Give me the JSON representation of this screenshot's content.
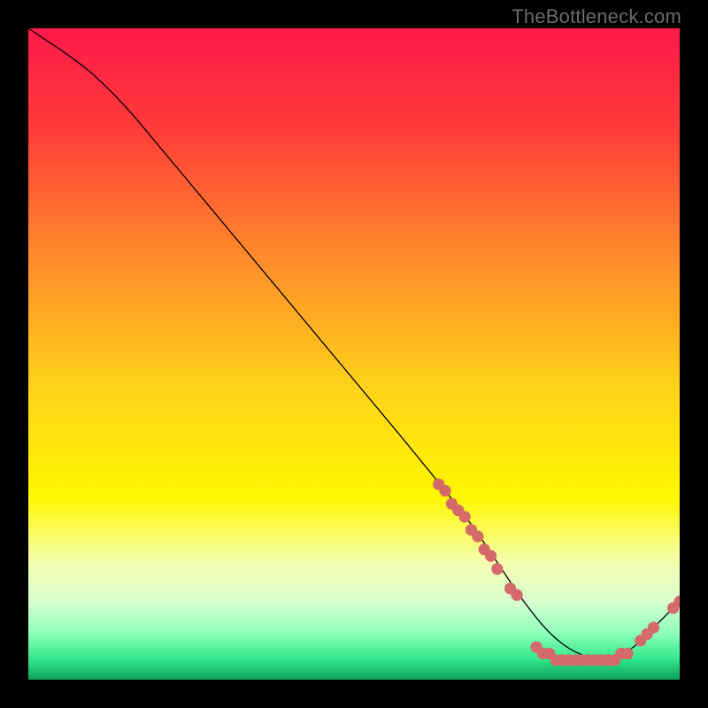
{
  "watermark": "TheBottleneck.com",
  "chart_data": {
    "type": "line",
    "title": "",
    "xlabel": "",
    "ylabel": "",
    "xlim": [
      0,
      100
    ],
    "ylim": [
      0,
      100
    ],
    "grid": false,
    "legend": false,
    "series": [
      {
        "name": "curve",
        "color": "#000000",
        "x": [
          0,
          3,
          6,
          10,
          15,
          20,
          30,
          40,
          50,
          60,
          68,
          72,
          76,
          80,
          84,
          88,
          92,
          96,
          100
        ],
        "y": [
          100,
          98,
          96,
          93,
          88,
          82,
          70,
          58,
          46,
          34,
          24,
          18,
          12,
          7,
          4,
          3,
          4,
          8,
          12
        ]
      }
    ],
    "marker_clusters": [
      {
        "name": "left-cluster",
        "color": "#d46a6a",
        "x": [
          63,
          64,
          65,
          66,
          67,
          68,
          69,
          70,
          71,
          72,
          74,
          75
        ],
        "y": [
          30,
          29,
          27,
          26,
          25,
          23,
          22,
          20,
          19,
          17,
          14,
          13
        ]
      },
      {
        "name": "bottom-cluster",
        "color": "#d46a6a",
        "x": [
          78,
          79,
          80,
          81,
          82,
          83,
          84,
          85,
          86,
          87,
          88,
          89,
          90,
          91,
          92
        ],
        "y": [
          5,
          4,
          4,
          3,
          3,
          3,
          3,
          3,
          3,
          3,
          3,
          3,
          3,
          4,
          4
        ]
      },
      {
        "name": "upturn-cluster",
        "color": "#d46a6a",
        "x": [
          94,
          95,
          96
        ],
        "y": [
          6,
          7,
          8
        ]
      },
      {
        "name": "tail-dots",
        "color": "#d46a6a",
        "x": [
          99,
          100
        ],
        "y": [
          11,
          12
        ]
      }
    ],
    "background_gradient": {
      "stops": [
        {
          "offset": 0.0,
          "color": "#ff1a4a"
        },
        {
          "offset": 0.15,
          "color": "#ff3a3a"
        },
        {
          "offset": 0.35,
          "color": "#ff8a2a"
        },
        {
          "offset": 0.55,
          "color": "#ffd21a"
        },
        {
          "offset": 0.72,
          "color": "#fff700"
        },
        {
          "offset": 0.82,
          "color": "#f5ffb0"
        },
        {
          "offset": 0.88,
          "color": "#d8ffcf"
        },
        {
          "offset": 0.93,
          "color": "#8affba"
        },
        {
          "offset": 0.97,
          "color": "#2ee58a"
        },
        {
          "offset": 1.0,
          "color": "#0fa05a"
        }
      ]
    }
  }
}
